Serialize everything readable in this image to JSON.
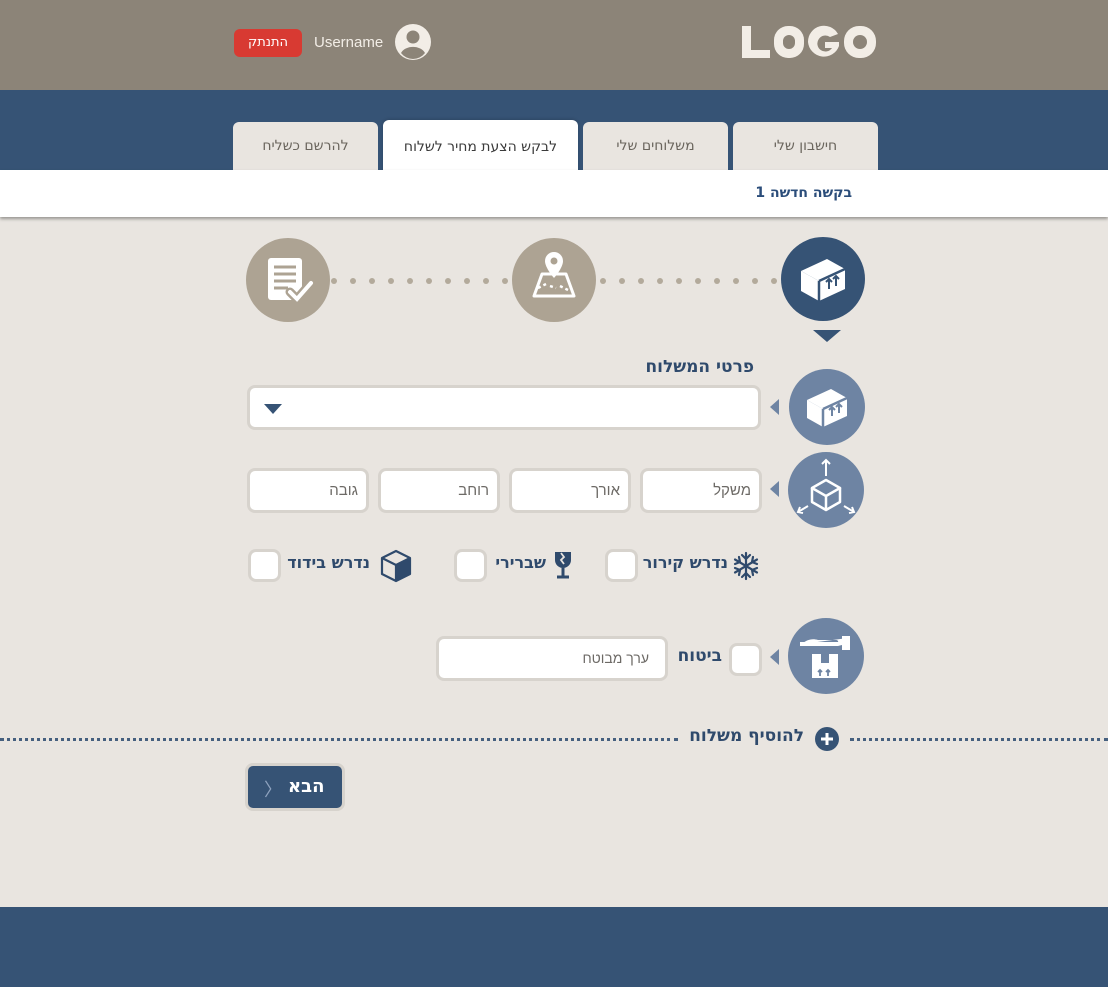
{
  "header": {
    "logo_text": "LOGO",
    "username": "Username",
    "logout_label": "התנתק"
  },
  "tabs": [
    {
      "label": "חישבון שלי",
      "active": false
    },
    {
      "label": "משלוחים שלי",
      "active": false
    },
    {
      "label": "לבקש הצעת מחיר לשלוח",
      "active": true
    },
    {
      "label": "להרשם כשליח",
      "active": false
    }
  ],
  "subnav": {
    "link": "בקשה חדשה 1"
  },
  "steps": [
    {
      "icon": "box-icon",
      "active": true
    },
    {
      "icon": "map-pin-icon",
      "active": false
    },
    {
      "icon": "checklist-icon",
      "active": false
    }
  ],
  "form": {
    "section_title": "פרטי המשלוח",
    "type_select_value": "",
    "dimensions": {
      "weight_placeholder": "משקל",
      "length_placeholder": "אורך",
      "width_placeholder": "רוחב",
      "height_placeholder": "גובה"
    },
    "options": {
      "refrigeration_label": "נדרש קירור",
      "fragile_label": "שברירי",
      "insulation_label": "נדרש בידוד"
    },
    "insurance": {
      "label": "ביטוח",
      "value_placeholder": "ערך מבוטח"
    },
    "add_shipment_label": "להוסיף משלוח",
    "next_label": "הבא"
  },
  "colors": {
    "header_bg": "#8c8478",
    "nav_bg": "#365375",
    "accent": "#2f4a6c",
    "logout": "#d83a32",
    "page_bg": "#e9e5e0"
  }
}
